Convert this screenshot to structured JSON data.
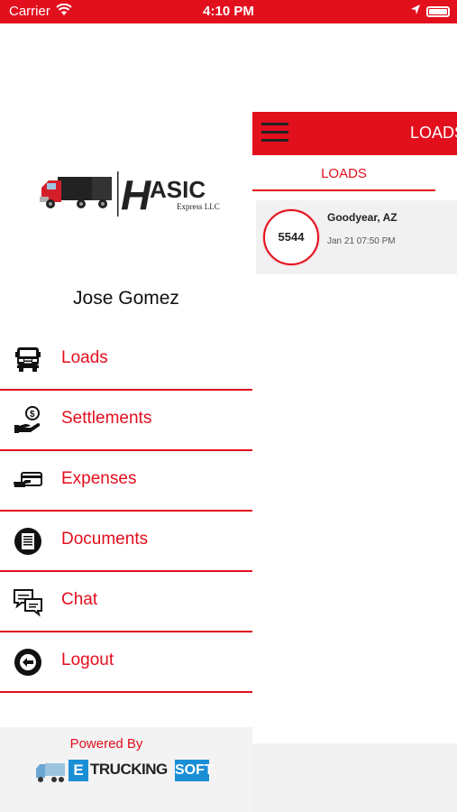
{
  "status_bar": {
    "carrier": "Carrier",
    "time": "4:10 PM"
  },
  "loads_screen": {
    "header_title": "LOADS",
    "tab_label": "LOADS",
    "loads": [
      {
        "number": "5544",
        "city": "Goodyear, AZ",
        "datetime": "Jan 21 07:50 PM"
      }
    ]
  },
  "drawer": {
    "logo": {
      "brand": "ASIC",
      "initial": "H",
      "subtitle": "Express LLC"
    },
    "user_name": "Jose Gomez",
    "menu": [
      {
        "label": "Loads",
        "icon": "truck-icon"
      },
      {
        "label": "Settlements",
        "icon": "hand-dollar-icon"
      },
      {
        "label": "Expenses",
        "icon": "card-hand-icon"
      },
      {
        "label": "Documents",
        "icon": "document-icon"
      },
      {
        "label": "Chat",
        "icon": "chat-icon"
      },
      {
        "label": "Logout",
        "icon": "logout-icon"
      }
    ],
    "footer": {
      "powered_by": "Powered By",
      "brand_e": "E",
      "brand_trucking": "TRUCKING",
      "brand_soft": "SOFT"
    }
  },
  "colors": {
    "accent": "#e20f1d",
    "brand_blue": "#1a8fd6"
  }
}
